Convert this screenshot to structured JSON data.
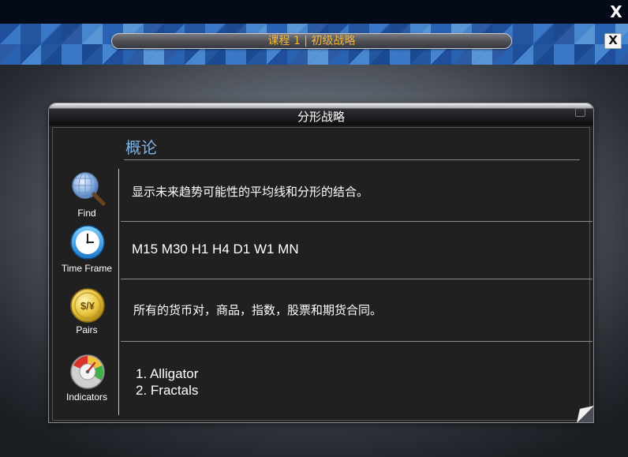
{
  "window": {
    "close_label": "X"
  },
  "banner": {
    "course_title": "课程 1 | 初级战略",
    "close_label": "X"
  },
  "panel": {
    "title": "分形战略",
    "section_title": "概论",
    "rows": [
      {
        "icon": "magnifier-globe-icon",
        "label": "Find",
        "text": "显示未来趋势可能性的平均线和分形的结合。"
      },
      {
        "icon": "clock-icon",
        "label": "Time Frame",
        "text": "M15  M30  H1  H4  D1  W1  MN"
      },
      {
        "icon": "currency-coin-icon",
        "label": "Pairs",
        "text": "所有的货币对，商品，指数，股票和期货合同。",
        "coin_text": "$/¥"
      },
      {
        "icon": "gauge-icon",
        "label": "Indicators",
        "items": [
          "1. Alligator",
          "2. Fractals"
        ]
      }
    ]
  },
  "colors": {
    "topbar": "#050a18",
    "banner": "#2a5fae",
    "course_title": "#f2b73a",
    "section_title": "#7fb3e5",
    "panel_bg": "#202020"
  }
}
